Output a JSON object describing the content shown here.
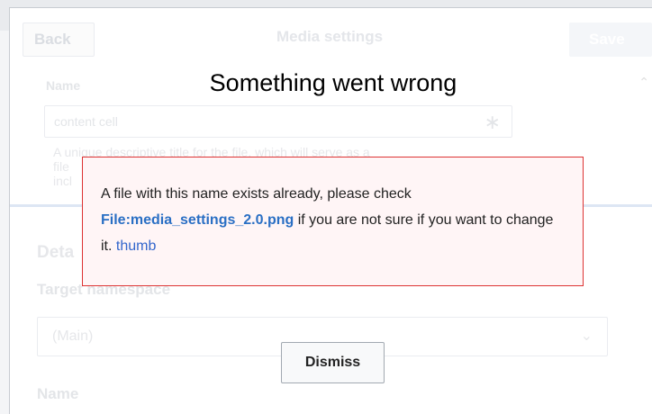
{
  "dialog": {
    "back_label": "Back",
    "title": "Media settings",
    "save_label": "Save"
  },
  "name_field": {
    "label": "Name",
    "value": "content cell",
    "required_icon": "asterisk-icon",
    "help_line1": "A unique descriptive title for the file, which will serve as a",
    "help_line2": "file",
    "help_line3": "incl"
  },
  "details": {
    "heading": "Deta",
    "namespace_label": "Target namespace",
    "namespace_value": "(Main)",
    "name_label": "Name"
  },
  "error": {
    "title": "Something went wrong",
    "text_before": "A file with this name exists already, please check",
    "file_link": "File:media_settings_2.0.png",
    "text_after": " if you are not sure if you want to change it. ",
    "thumb_link": "thumb",
    "dismiss_label": "Dismiss",
    "border_color": "#dd3333",
    "background_color": "#fff5f6"
  }
}
